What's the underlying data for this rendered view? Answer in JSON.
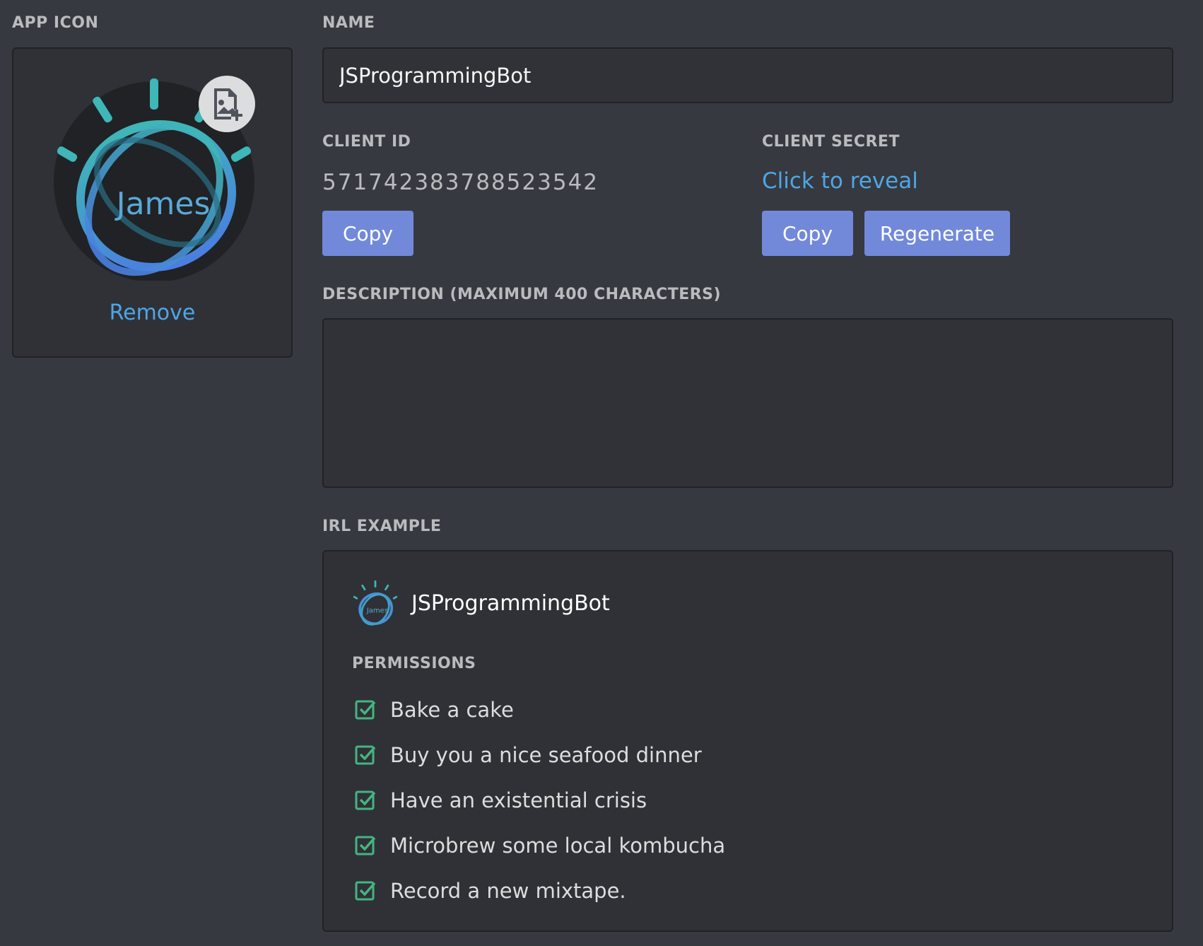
{
  "app_icon": {
    "label": "APP ICON",
    "avatar_text": "James",
    "upload_icon": "image-upload-icon",
    "remove_label": "Remove"
  },
  "name": {
    "label": "NAME",
    "value": "JSProgrammingBot"
  },
  "client_id": {
    "label": "CLIENT ID",
    "value": "571742383788523542",
    "copy_label": "Copy"
  },
  "client_secret": {
    "label": "CLIENT SECRET",
    "reveal_label": "Click to reveal",
    "copy_label": "Copy",
    "regenerate_label": "Regenerate"
  },
  "description": {
    "label": "DESCRIPTION (MAXIMUM 400 CHARACTERS)",
    "value": ""
  },
  "irl_example": {
    "label": "IRL EXAMPLE",
    "bot_name": "JSProgrammingBot",
    "permissions_label": "PERMISSIONS",
    "permissions": [
      "Bake a cake",
      "Buy you a nice seafood dinner",
      "Have an existential crisis",
      "Microbrew some local kombucha",
      "Record a new mixtape."
    ]
  },
  "colors": {
    "background": "#36393f",
    "panel": "#2f3136",
    "accent_button": "#7289da",
    "link": "#4ea6e6",
    "check_green": "#43b581"
  }
}
